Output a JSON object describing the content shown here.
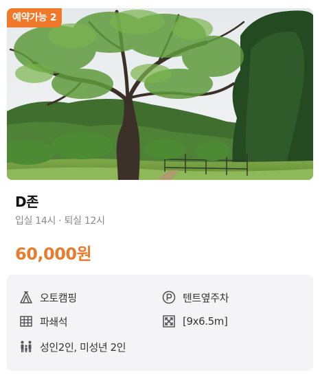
{
  "badge": {
    "text": "예약가능 2",
    "color": "#f0782b"
  },
  "site": {
    "name": "D존",
    "hours": "입실 14시 · 퇴실 12시",
    "price": "60,000원",
    "price_color": "#e87b2c"
  },
  "features": [
    {
      "icon": "tent-icon",
      "label": "오토캠핑"
    },
    {
      "icon": "parking-icon",
      "label": "텐트옆주차"
    },
    {
      "icon": "grid-floor-icon",
      "label": "파쇄석"
    },
    {
      "icon": "expand-size-icon",
      "label": "[9x6.5m]"
    },
    {
      "icon": "family-people-icon",
      "label": "성인2인, 미성년 2인"
    }
  ],
  "colors": {
    "info_background": "#f4f4f6",
    "icon_gray": "#555555"
  }
}
